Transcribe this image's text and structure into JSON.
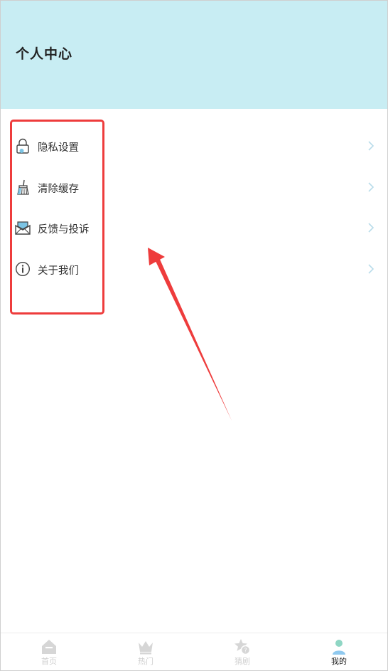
{
  "header": {
    "title": "个人中心",
    "background_color": "#c8edf3"
  },
  "menu": {
    "items": [
      {
        "label": "隐私设置",
        "icon": "lock-icon"
      },
      {
        "label": "清除缓存",
        "icon": "broom-icon"
      },
      {
        "label": "反馈与投诉",
        "icon": "mail-icon"
      },
      {
        "label": "关于我们",
        "icon": "info-icon"
      }
    ],
    "chevron_icon": "chevron-right-icon"
  },
  "annotation": {
    "highlight_color": "#ee3c3c"
  },
  "tabbar": {
    "items": [
      {
        "label": "首页",
        "icon": "home-icon",
        "active": false
      },
      {
        "label": "热门",
        "icon": "crown-icon",
        "active": false
      },
      {
        "label": "猜剧",
        "icon": "star-badge-icon",
        "active": false
      },
      {
        "label": "我的",
        "icon": "user-icon",
        "active": true
      }
    ],
    "active_color": "#222222",
    "inactive_color": "#cfcfcf"
  }
}
